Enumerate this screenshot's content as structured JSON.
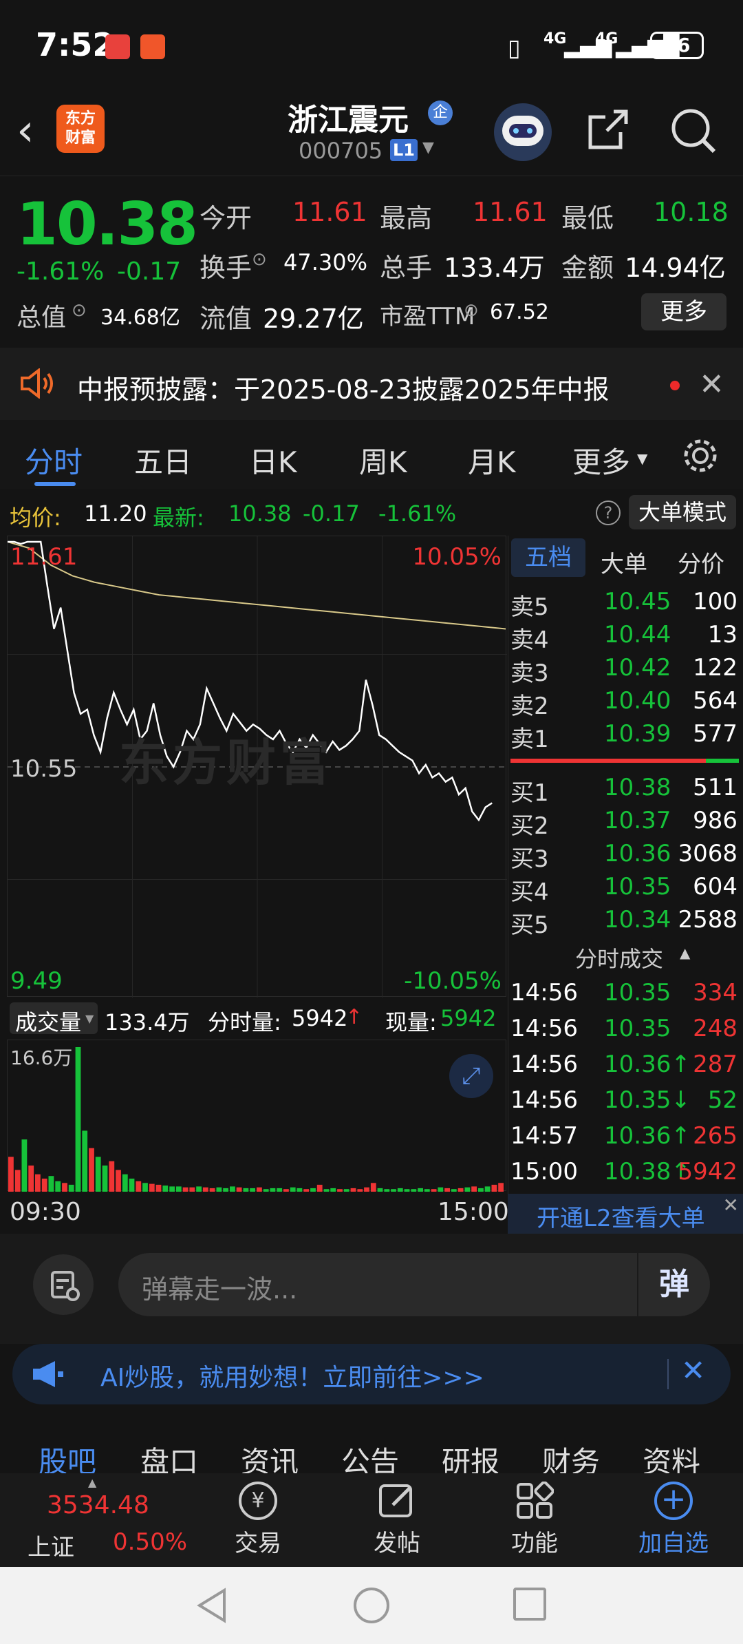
{
  "status": {
    "time": "7:52",
    "battery": "76",
    "net1": "4G",
    "net2": "4G"
  },
  "header": {
    "app_logo_line1": "东方",
    "app_logo_line2": "财富",
    "stock_name": "浙江震元",
    "badge": "企",
    "code": "000705",
    "level": "L1"
  },
  "quote": {
    "price": "10.38",
    "change_pct": "-1.61%",
    "change": "-0.17",
    "open_label": "今开",
    "open": "11.61",
    "high_label": "最高",
    "high": "11.61",
    "low_label": "最低",
    "low": "10.18",
    "turnover_label": "换手",
    "turnover": "47.30%",
    "volume_label": "总手",
    "volume": "133.4万",
    "amount_label": "金额",
    "amount": "14.94亿",
    "mktcap_label": "总值",
    "mktcap": "34.68亿",
    "float_label": "流值",
    "float": "29.27亿",
    "pe_label": "市盈TTM",
    "pe": "67.52",
    "more": "更多"
  },
  "notice": {
    "text": "中报预披露：于2025-08-23披露2025年中报"
  },
  "tabs": [
    "分时",
    "五日",
    "日K",
    "周K",
    "月K",
    "更多"
  ],
  "chart_header": {
    "avg_label": "均价:",
    "avg": "11.20",
    "latest_label": "最新:",
    "latest": "10.38",
    "chg": "-0.17",
    "chg_pct": "-1.61%",
    "mode_btn": "大单模式"
  },
  "chart": {
    "top_price": "11.61",
    "top_pct": "10.05%",
    "mid_price": "10.55",
    "bottom_price": "9.49",
    "bottom_pct": "-10.05%",
    "watermark": "东方财富",
    "vol_label": "成交量",
    "vol_total": "133.4万",
    "min_vol_label": "分时量:",
    "min_vol": "5942",
    "cur_vol_label": "现量:",
    "cur_vol": "5942",
    "vol_max": "16.6万",
    "time_start": "09:30",
    "time_end": "15:00"
  },
  "chart_data": {
    "type": "line",
    "y_range": [
      9.49,
      11.61
    ],
    "price": [
      11.61,
      11.61,
      11.6,
      11.61,
      11.61,
      11.61,
      11.4,
      11.2,
      11.3,
      11.1,
      10.9,
      10.8,
      10.82,
      10.7,
      10.62,
      10.78,
      10.9,
      10.82,
      10.75,
      10.82,
      10.68,
      10.72,
      10.85,
      10.7,
      10.6,
      10.55,
      10.62,
      10.72,
      10.68,
      10.75,
      10.92,
      10.85,
      10.78,
      10.72,
      10.8,
      10.76,
      10.72,
      10.75,
      10.73,
      10.7,
      10.68,
      10.72,
      10.66,
      10.62,
      10.68,
      10.64,
      10.7,
      10.66,
      10.62,
      10.67,
      10.63,
      10.65,
      10.68,
      10.72,
      10.96,
      10.84,
      10.7,
      10.68,
      10.65,
      10.62,
      10.6,
      10.58,
      10.52,
      10.56,
      10.5,
      10.52,
      10.48,
      10.5,
      10.42,
      10.45,
      10.34,
      10.3,
      10.36,
      10.38
    ],
    "avg": [
      11.61,
      11.58,
      11.5,
      11.45,
      11.42,
      11.4,
      11.38,
      11.36,
      11.35,
      11.34,
      11.33,
      11.32,
      11.31,
      11.3,
      11.29,
      11.28,
      11.27,
      11.26,
      11.25,
      11.24,
      11.23,
      11.22,
      11.21,
      11.2
    ],
    "volume_max": 166000,
    "volume": [
      40000,
      25000,
      60000,
      30000,
      20000,
      15000,
      18000,
      12000,
      10000,
      8000,
      166000,
      70000,
      50000,
      40000,
      30000,
      35000,
      25000,
      20000,
      15000,
      12000,
      10000,
      9000,
      8000,
      7000,
      6000,
      6000,
      5000,
      5000,
      6000,
      5000,
      4000,
      5000,
      4000,
      6000,
      5000,
      4000,
      4000,
      5000,
      3000,
      4000,
      4000,
      3000,
      5000,
      4000,
      3000,
      4000,
      8000,
      3000,
      4000,
      3000,
      3000,
      4000,
      3000,
      5000,
      10000,
      4000,
      3000,
      3000,
      4000,
      3000,
      3000,
      4000,
      3000,
      3000,
      5000,
      4000,
      3000,
      4000,
      5000,
      6000,
      4000,
      6000,
      8000,
      10000
    ]
  },
  "orderbook": {
    "tabs": [
      "五档",
      "大单",
      "分价"
    ],
    "sells": [
      {
        "label": "卖5",
        "price": "10.45",
        "vol": "100"
      },
      {
        "label": "卖4",
        "price": "10.44",
        "vol": "13"
      },
      {
        "label": "卖3",
        "price": "10.42",
        "vol": "122"
      },
      {
        "label": "卖2",
        "price": "10.40",
        "vol": "564"
      },
      {
        "label": "卖1",
        "price": "10.39",
        "vol": "577"
      }
    ],
    "buys": [
      {
        "label": "买1",
        "price": "10.38",
        "vol": "511"
      },
      {
        "label": "买2",
        "price": "10.37",
        "vol": "986"
      },
      {
        "label": "买3",
        "price": "10.36",
        "vol": "3068"
      },
      {
        "label": "买4",
        "price": "10.35",
        "vol": "604"
      },
      {
        "label": "买5",
        "price": "10.34",
        "vol": "2588"
      }
    ],
    "ticks_title": "分时成交",
    "ticks": [
      {
        "t": "14:56",
        "price": "10.35",
        "vol": "334"
      },
      {
        "t": "14:56",
        "price": "10.35",
        "vol": "248"
      },
      {
        "t": "14:56",
        "price": "10.36↑",
        "vol": "287"
      },
      {
        "t": "14:56",
        "price": "10.35↓",
        "vol": "52"
      },
      {
        "t": "14:57",
        "price": "10.36↑",
        "vol": "265"
      },
      {
        "t": "15:00",
        "price": "10.38↑",
        "vol": "5942"
      }
    ],
    "l2": "开通L2查看大单"
  },
  "danmu": {
    "placeholder": "弹幕走一波...",
    "btn": "弹"
  },
  "ai_banner": {
    "text": "AI炒股，就用妙想！立即前往>>>"
  },
  "section_tabs": [
    "股吧",
    "盘口",
    "资讯",
    "公告",
    "研报",
    "财务",
    "资料"
  ],
  "index": {
    "value": "3534.48",
    "name": "上证",
    "pct": "0.50%"
  },
  "nav": [
    {
      "label": "交易",
      "icon": "yen-icon"
    },
    {
      "label": "发帖",
      "icon": "edit-icon"
    },
    {
      "label": "功能",
      "icon": "grid-icon"
    },
    {
      "label": "加自选",
      "icon": "plus-icon"
    }
  ]
}
